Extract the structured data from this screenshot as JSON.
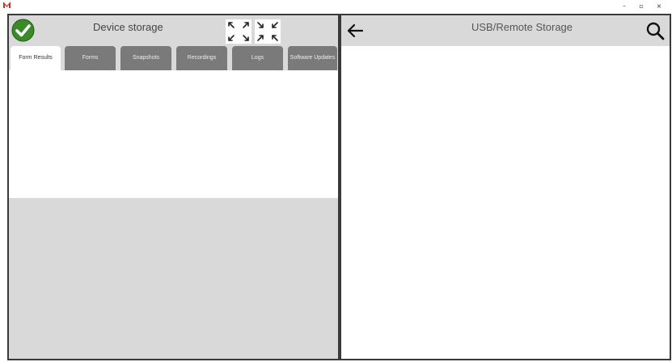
{
  "window": {
    "minimize_label": "–",
    "maximize_label": "▫",
    "close_label": "×",
    "logo_color": "#c0392b"
  },
  "device_storage": {
    "title": "Device storage",
    "status_icon": "check-circle-icon",
    "status_color": "#3a8a2a",
    "tabs": [
      {
        "label": "Form Results",
        "active": true
      },
      {
        "label": "Forms",
        "active": false
      },
      {
        "label": "Snapshots",
        "active": false
      },
      {
        "label": "Recordings",
        "active": false
      },
      {
        "label": "Logs",
        "active": false
      },
      {
        "label": "Software Updates",
        "active": false
      }
    ]
  },
  "remote_storage": {
    "title": "USB/Remote Storage",
    "back_icon": "arrow-left-icon",
    "search_icon": "search-icon"
  }
}
